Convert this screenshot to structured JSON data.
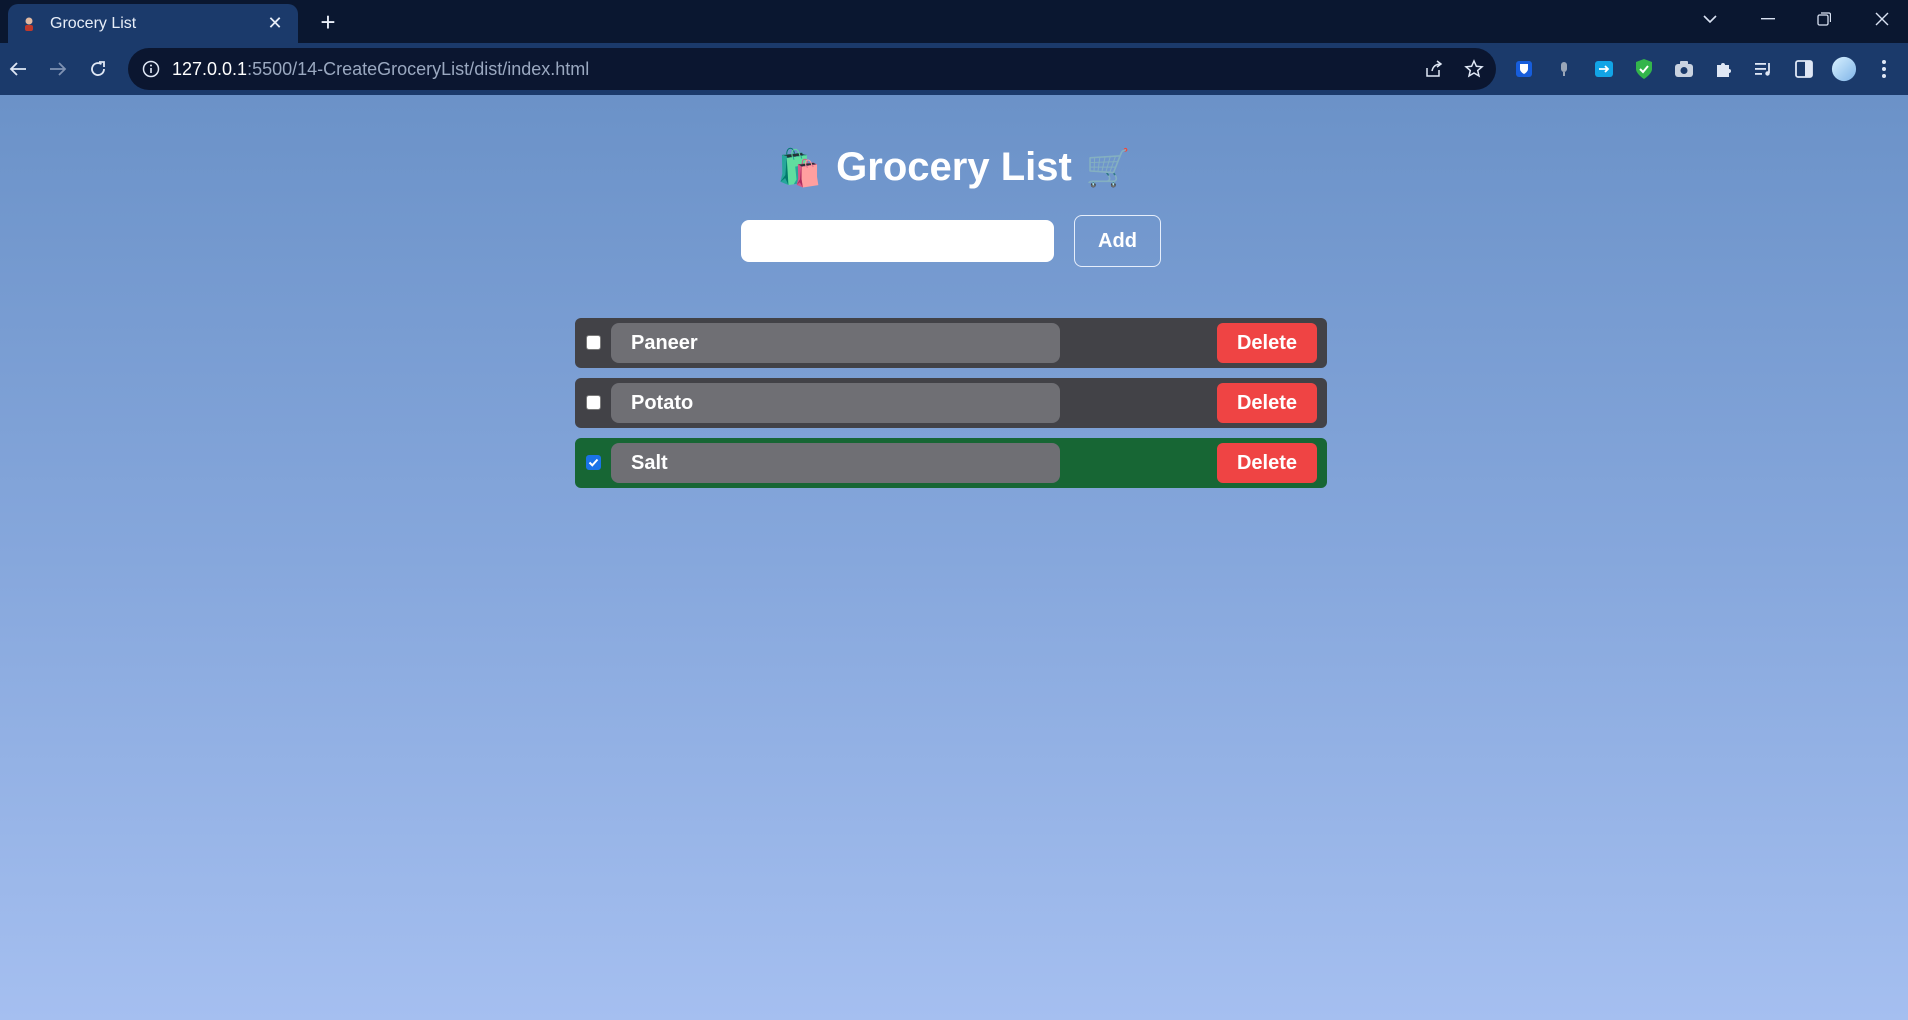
{
  "browser": {
    "tab_title": "Grocery List",
    "url_host": "127.0.0.1",
    "url_rest": ":5500/14-CreateGroceryList/dist/index.html"
  },
  "page": {
    "title": "Grocery List",
    "title_emoji_left": "🛍️",
    "title_emoji_right": "🛒",
    "input_value": "",
    "add_label": "Add",
    "items": [
      {
        "name": "Paneer",
        "checked": false,
        "delete_label": "Delete"
      },
      {
        "name": "Potato",
        "checked": false,
        "delete_label": "Delete"
      },
      {
        "name": "Salt",
        "checked": true,
        "delete_label": "Delete"
      }
    ]
  },
  "colors": {
    "accent_delete": "#ef4444",
    "item_background": "#424247",
    "item_checked_background": "#176634"
  },
  "icons": {
    "toolbar": [
      "back-arrow-icon",
      "forward-arrow-icon",
      "reload-icon",
      "info-icon",
      "share-icon",
      "star-icon"
    ],
    "extensions": [
      "bitwarden-icon",
      "mic-icon",
      "cast-icon",
      "shield-check-icon",
      "camera-icon",
      "puzzle-icon",
      "media-icon",
      "side-panel-icon",
      "profile-avatar"
    ]
  }
}
